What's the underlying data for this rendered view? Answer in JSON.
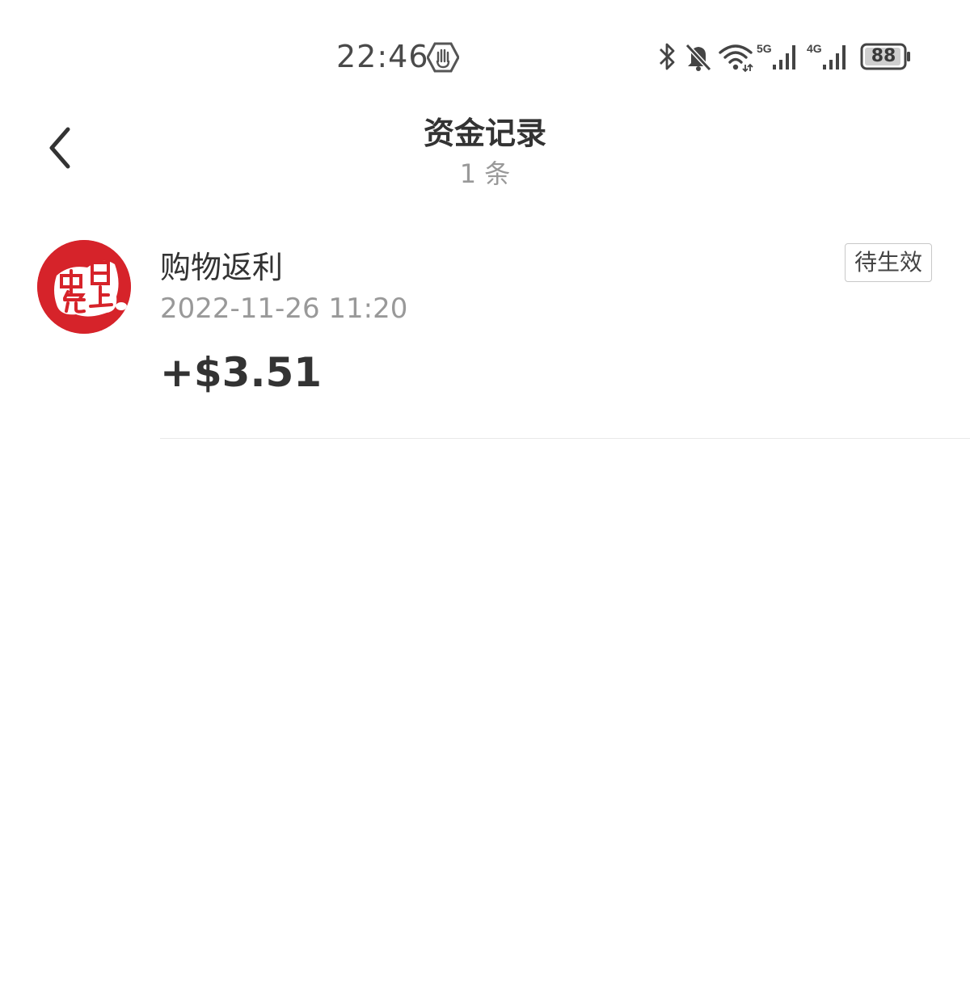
{
  "status_bar": {
    "time": "22:46",
    "battery": "88",
    "icons": [
      "hand-icon",
      "bluetooth-icon",
      "bell-off-icon",
      "wifi-icon",
      "signal-5g-icon",
      "signal-4g-icon",
      "battery-icon"
    ],
    "sig5_label": "5G",
    "sig4_label": "4G"
  },
  "header": {
    "back_icon": "chevron-left-icon",
    "title": "资金记录",
    "subtitle": "1 条"
  },
  "records": [
    {
      "avatar_logo_text": "日上中免",
      "title": "购物返利",
      "time": "2022-11-26 11:20",
      "amount": "+$3.51",
      "status": "待生效"
    }
  ],
  "colors": {
    "brand_red": "#d6232a",
    "text_primary": "#333333",
    "text_secondary": "#999999"
  }
}
